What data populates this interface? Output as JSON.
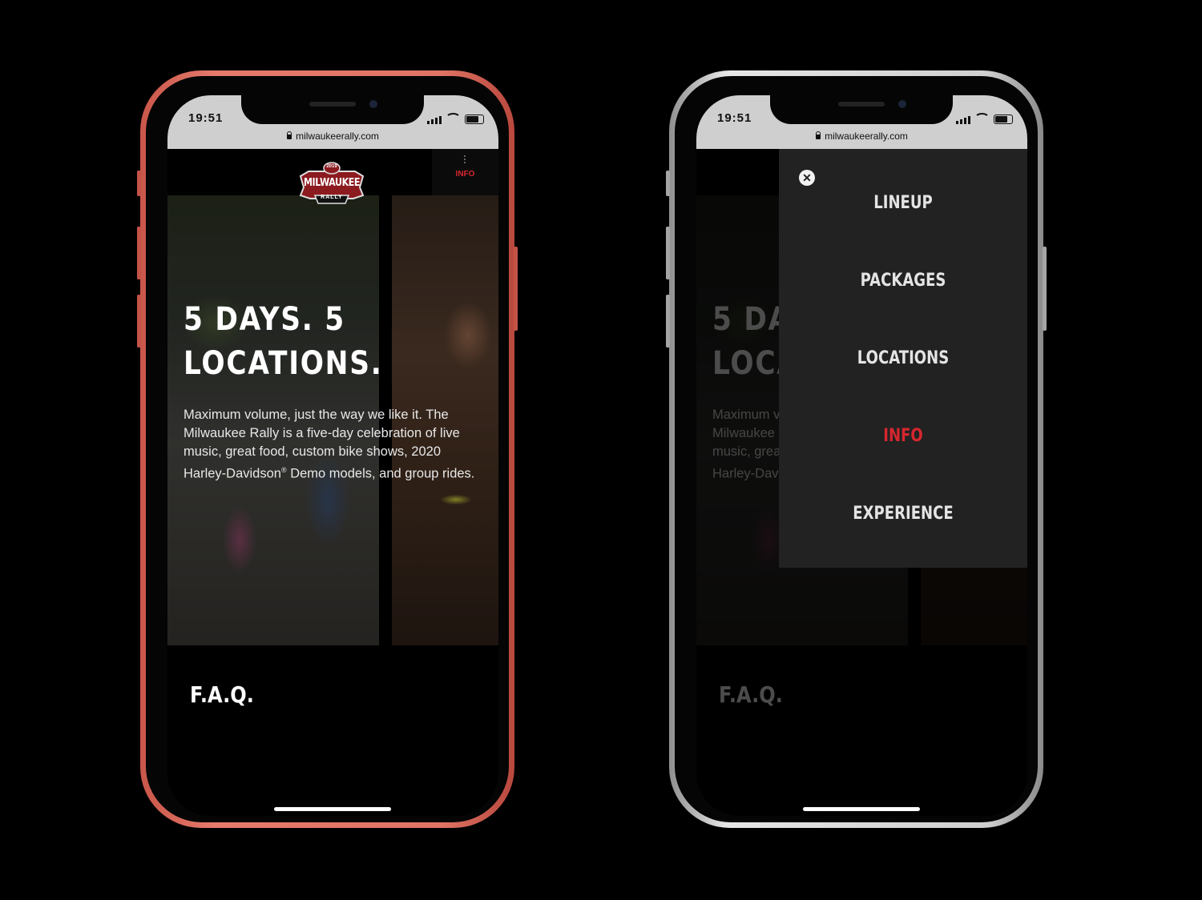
{
  "status": {
    "time": "19:51",
    "url": "milwaukeerally.com"
  },
  "header": {
    "logo_top": "2019",
    "logo_main": "MILWAUKEE",
    "logo_sub": "RALLY",
    "menu_tab_label": "INFO"
  },
  "hero": {
    "title_line1": "5 DAYS. 5",
    "title_line2": "LOCATIONS.",
    "body_part1": "Maximum volume, just the way we like it. The Milwaukee Rally is a five-day celebration of live music, great food, custom bike shows, 2020 Harley-Davidson",
    "registered": "®",
    "body_part2": " Demo models, and group rides."
  },
  "faq": {
    "heading": "F.A.Q."
  },
  "menu": {
    "items": [
      "LINEUP",
      "PACKAGES",
      "LOCATIONS",
      "INFO",
      "EXPERIENCE"
    ],
    "active": "INFO"
  },
  "colors": {
    "accent": "#d8262e",
    "menu_bg": "#222222",
    "coral_frame": "#e07464",
    "silver_frame": "#d0d0d0"
  }
}
